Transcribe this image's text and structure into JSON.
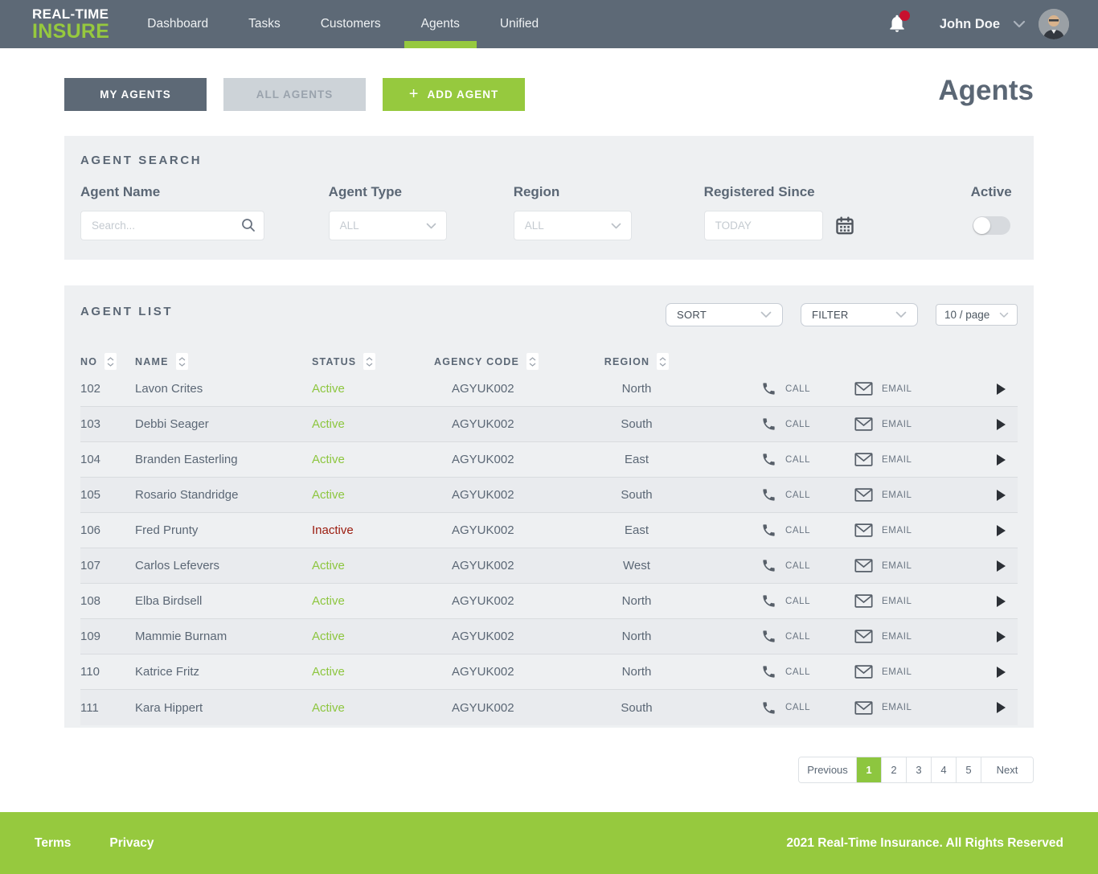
{
  "nav": {
    "logo_line1": "REAL-TIME",
    "logo_line2": "INSURE",
    "items": [
      {
        "label": "Dashboard",
        "active": false
      },
      {
        "label": "Tasks",
        "active": false
      },
      {
        "label": "Customers",
        "active": false
      },
      {
        "label": "Agents",
        "active": true
      },
      {
        "label": "Unified",
        "active": false
      }
    ],
    "user_name": "John Doe",
    "notification_badge": true
  },
  "toolbar": {
    "my_agents_label": "MY AGENTS",
    "all_agents_label": "ALL AGENTS",
    "add_agent_plus": "+",
    "add_agent_label": "ADD AGENT",
    "page_title": "Agents"
  },
  "search": {
    "title": "AGENT SEARCH",
    "agent_name_label": "Agent Name",
    "agent_name_placeholder": "Search...",
    "agent_type_label": "Agent Type",
    "agent_type_value": "ALL",
    "region_label": "Region",
    "region_value": "ALL",
    "registered_label": "Registered Since",
    "registered_placeholder": "TODAY",
    "active_label": "Active",
    "active_toggle_state": "off"
  },
  "list": {
    "title": "AGENT LIST",
    "sort_label": "SORT",
    "filter_label": "FILTER",
    "per_page_label": "10 / page",
    "columns": [
      "NO",
      "NAME",
      "STATUS",
      "AGENCY CODE",
      "REGION"
    ],
    "call_label": "CALL",
    "email_label": "EMAIL",
    "rows": [
      {
        "no": "102",
        "name": "Lavon Crites",
        "status": "Active",
        "agency_code": "AGYUK002",
        "region": "North"
      },
      {
        "no": "103",
        "name": "Debbi Seager",
        "status": "Active",
        "agency_code": "AGYUK002",
        "region": "South"
      },
      {
        "no": "104",
        "name": "Branden Easterling",
        "status": "Active",
        "agency_code": "AGYUK002",
        "region": "East"
      },
      {
        "no": "105",
        "name": "Rosario Standridge",
        "status": "Active",
        "agency_code": "AGYUK002",
        "region": "South"
      },
      {
        "no": "106",
        "name": "Fred Prunty",
        "status": "Inactive",
        "agency_code": "AGYUK002",
        "region": "East"
      },
      {
        "no": "107",
        "name": "Carlos Lefevers",
        "status": "Active",
        "agency_code": "AGYUK002",
        "region": "West"
      },
      {
        "no": "108",
        "name": "Elba Birdsell",
        "status": "Active",
        "agency_code": "AGYUK002",
        "region": "North"
      },
      {
        "no": "109",
        "name": "Mammie Burnam",
        "status": "Active",
        "agency_code": "AGYUK002",
        "region": "North"
      },
      {
        "no": "110",
        "name": "Katrice Fritz",
        "status": "Active",
        "agency_code": "AGYUK002",
        "region": "North"
      },
      {
        "no": "111",
        "name": "Kara Hippert",
        "status": "Active",
        "agency_code": "AGYUK002",
        "region": "South"
      }
    ]
  },
  "pagination": {
    "previous_label": "Previous",
    "pages": [
      "1",
      "2",
      "3",
      "4",
      "5"
    ],
    "active_page": "1",
    "next_label": "Next"
  },
  "footer": {
    "terms_label": "Terms",
    "privacy_label": "Privacy",
    "copyright": "2021 Real-Time Insurance. All Rights Reserved"
  },
  "colors": {
    "accent_green": "#96c93e",
    "status_active": "#8dc63f",
    "status_inactive": "#9b1b0e",
    "navbar": "#5d6976",
    "panel_bg": "#eef0f2",
    "notification_dot": "#c8102e"
  }
}
